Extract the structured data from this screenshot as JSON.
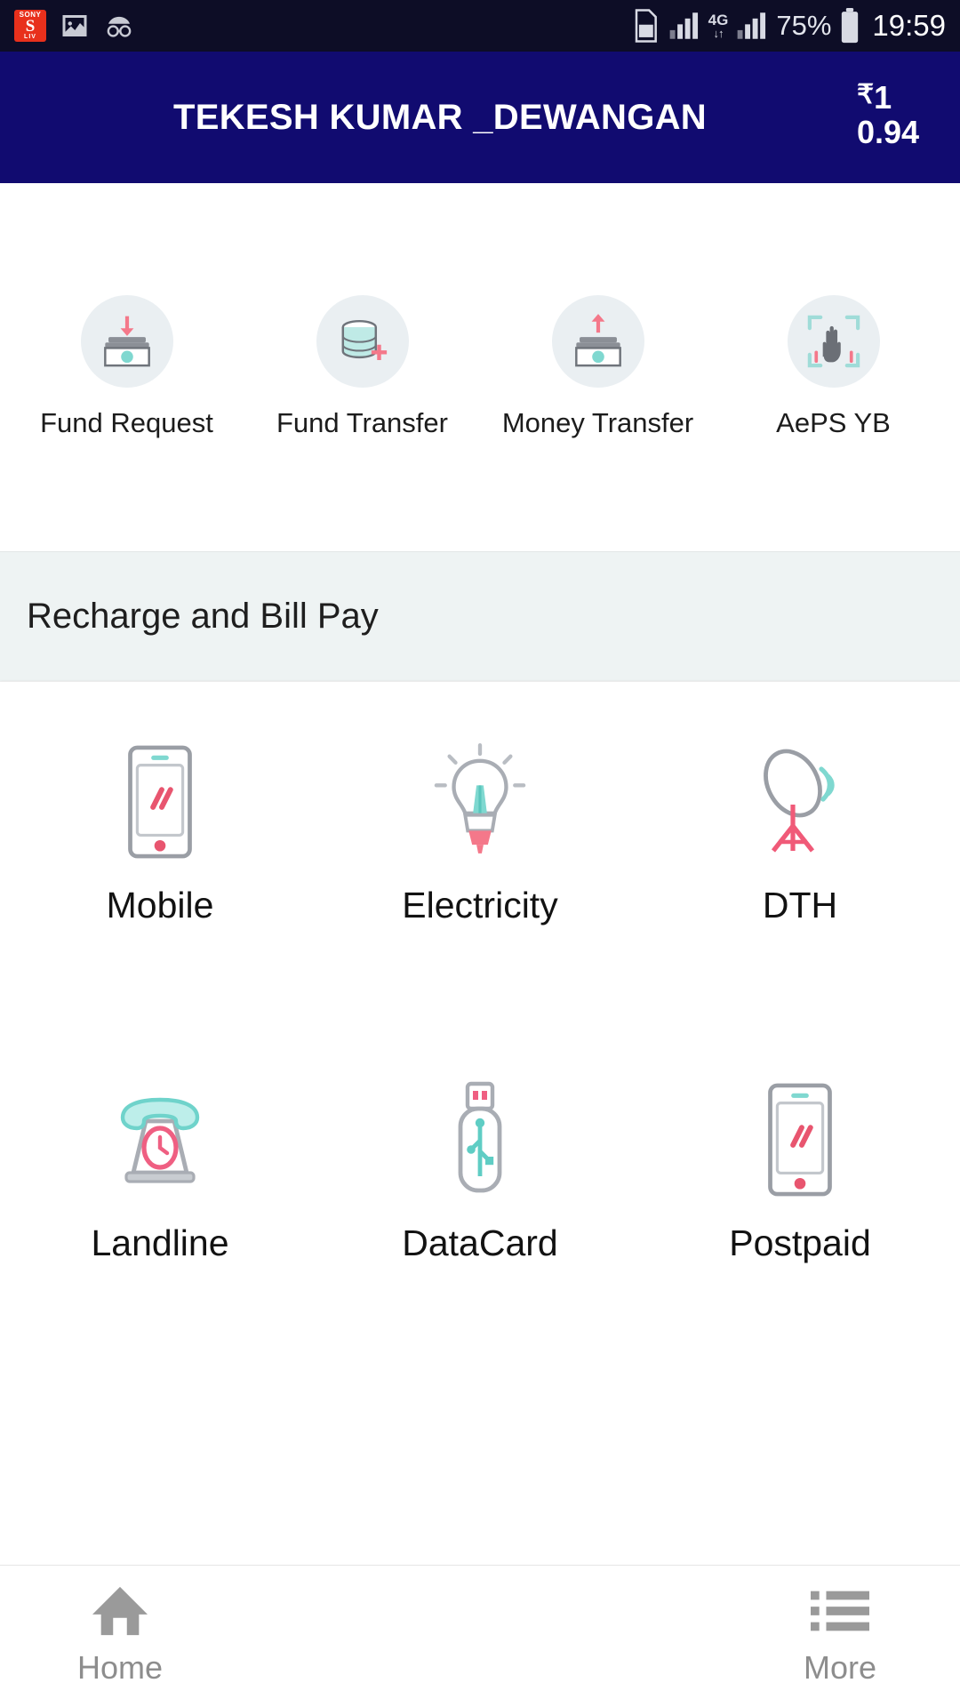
{
  "statusbar": {
    "app_icons": [
      {
        "name": "sonyliv-icon",
        "label_top": "SONY",
        "label_mid": "S",
        "label_bottom": "LIV"
      },
      {
        "name": "gallery-icon"
      },
      {
        "name": "incognito-icon"
      }
    ],
    "sim_icon": "sim-card-icon",
    "signal_one": "signal-bars-icon",
    "network_type": "4G",
    "network_arrows": "↓↑",
    "signal_two": "signal-bars-icon",
    "battery_percent": "75%",
    "battery_icon": "battery-icon",
    "time": "19:59"
  },
  "header": {
    "title": "TEKESH KUMAR _DEWANGAN",
    "currency_symbol": "₹",
    "balance_line1": "1",
    "balance_line2": "0.94",
    "balance_full": "₹ 10.94",
    "background_color": "#110b70"
  },
  "quick_actions": [
    {
      "label": "Fund Request",
      "icon": "money-down-arrow-icon"
    },
    {
      "label": "Fund Transfer",
      "icon": "database-plus-icon"
    },
    {
      "label": "Money Transfer",
      "icon": "money-up-arrow-icon"
    },
    {
      "label": "AePS YB",
      "icon": "fingerprint-hand-scan-icon"
    }
  ],
  "section": {
    "title": "Recharge and Bill Pay",
    "background_color": "#eef3f3"
  },
  "bill_services": [
    [
      {
        "label": "Mobile",
        "icon": "smartphone-icon"
      },
      {
        "label": "Electricity",
        "icon": "light-bulb-icon"
      },
      {
        "label": "DTH",
        "icon": "satellite-dish-icon"
      }
    ],
    [
      {
        "label": "Landline",
        "icon": "rotary-phone-icon"
      },
      {
        "label": "DataCard",
        "icon": "usb-dongle-icon"
      },
      {
        "label": "Postpaid",
        "icon": "smartphone-icon"
      }
    ]
  ],
  "bottom_nav": [
    {
      "label": "Home",
      "icon": "home-icon"
    },
    {
      "label": "More",
      "icon": "list-menu-icon"
    }
  ],
  "colors": {
    "brand_navy": "#110b70",
    "accent_pink": "#f4788a",
    "accent_teal": "#7fd8d0",
    "icon_grey": "#8b8f96"
  }
}
